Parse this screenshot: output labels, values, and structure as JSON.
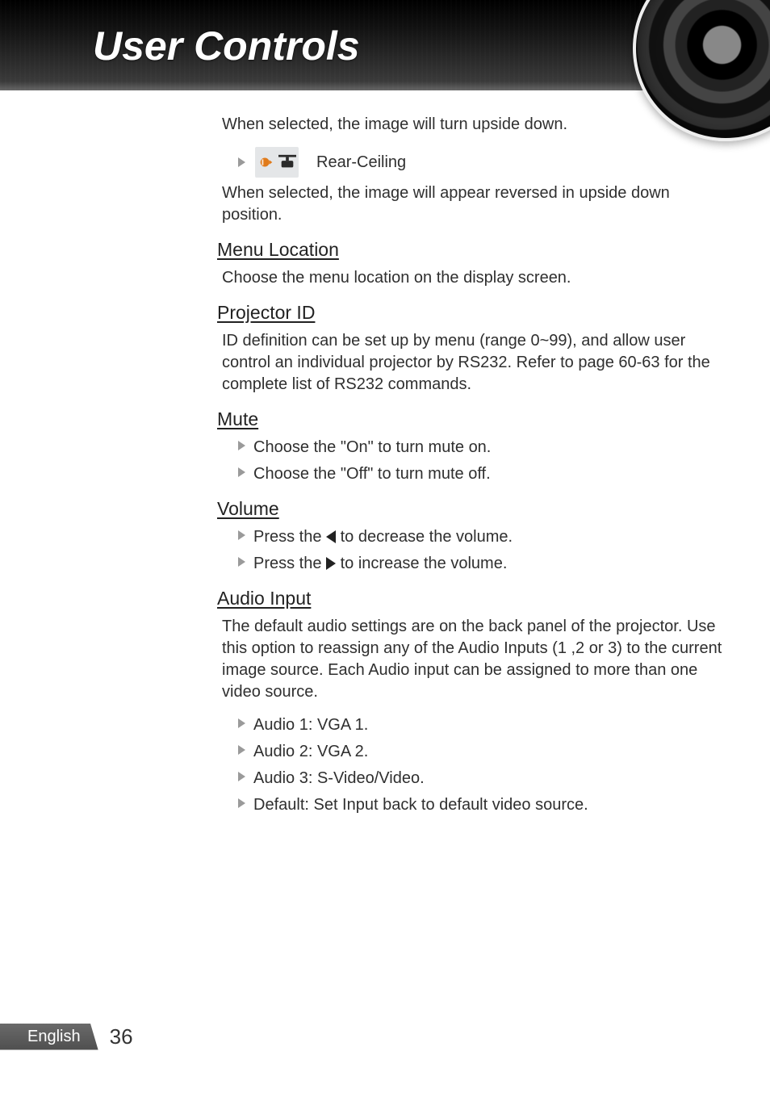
{
  "header": {
    "title": "User Controls"
  },
  "body": {
    "intro_selected_upside": "When selected, the image will turn upside down.",
    "rear_ceiling_label": "Rear-Ceiling",
    "rear_ceiling_desc": "When selected, the image will appear reversed in upside down position.",
    "menu_location": {
      "heading": "Menu Location",
      "desc": "Choose the menu location on the display screen."
    },
    "projector_id": {
      "heading": "Projector ID",
      "desc": "ID definition can be set up by menu (range 0~99), and allow user control an individual projector by RS232. Refer to page 60-63 for the complete list of RS232 commands."
    },
    "mute": {
      "heading": "Mute",
      "items": [
        "Choose the \"On\" to turn mute on.",
        "Choose the \"Off\" to turn mute off."
      ]
    },
    "volume": {
      "heading": "Volume",
      "dec_pre": "Press the ",
      "dec_post": " to decrease the volume.",
      "inc_pre": "Press the ",
      "inc_post": " to increase the volume."
    },
    "audio_input": {
      "heading": "Audio Input",
      "desc": "The default audio settings are on the back panel of the projector. Use this option to reassign any of the Audio Inputs (1 ,2 or 3) to the current image source. Each Audio input can be assigned to more than one video source.",
      "items": [
        "Audio 1: VGA 1.",
        "Audio 2: VGA 2.",
        "Audio 3: S-Video/Video.",
        "Default: Set Input back to default video source."
      ]
    }
  },
  "footer": {
    "language": "English",
    "page": "36"
  }
}
